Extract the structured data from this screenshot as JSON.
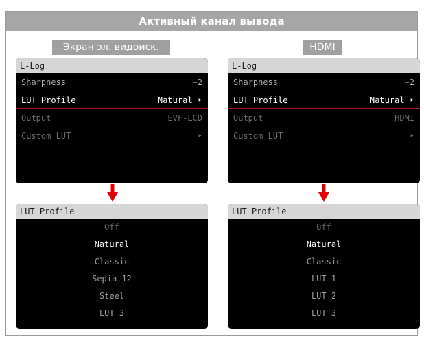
{
  "title": "Активный канал вывода",
  "columns": [
    {
      "label": "Экран эл. видоиск.",
      "menu": {
        "header": "L-Log",
        "rows": [
          {
            "label": "Sharpness",
            "value": "−2",
            "state": "norm"
          },
          {
            "label": "LUT Profile",
            "value": "Natural ‣",
            "state": "sel"
          },
          {
            "label": "Output",
            "value": "EVF-LCD",
            "state": "dim"
          },
          {
            "label": "Custom LUT",
            "value": "‣",
            "state": "dim"
          }
        ]
      },
      "list": {
        "header": "LUT Profile",
        "items": [
          {
            "label": "Off",
            "state": "dim"
          },
          {
            "label": "Natural",
            "state": "sel"
          },
          {
            "label": "Classic",
            "state": "norm"
          },
          {
            "label": "Sepia 12",
            "state": "norm"
          },
          {
            "label": "Steel",
            "state": "norm"
          },
          {
            "label": "LUT 3",
            "state": "norm"
          }
        ]
      }
    },
    {
      "label": "HDMI",
      "menu": {
        "header": "L-Log",
        "rows": [
          {
            "label": "Sharpness",
            "value": "−2",
            "state": "norm"
          },
          {
            "label": "LUT Profile",
            "value": "Natural ‣",
            "state": "sel"
          },
          {
            "label": "Output",
            "value": "HDMI",
            "state": "dim"
          },
          {
            "label": "Custom LUT",
            "value": "‣",
            "state": "dim"
          }
        ]
      },
      "list": {
        "header": "LUT Profile",
        "items": [
          {
            "label": "Off",
            "state": "dim"
          },
          {
            "label": "Natural",
            "state": "sel"
          },
          {
            "label": "Classic",
            "state": "norm"
          },
          {
            "label": "LUT 1",
            "state": "norm"
          },
          {
            "label": "LUT 2",
            "state": "norm"
          },
          {
            "label": "LUT 3",
            "state": "norm"
          }
        ]
      }
    }
  ],
  "colors": {
    "accent_red": "#e00000",
    "frame_gray": "#a6a6a6",
    "screen_black": "#000000"
  },
  "icons": {
    "arrow": "arrow-down-icon",
    "submenu": "chevron-right-icon"
  }
}
